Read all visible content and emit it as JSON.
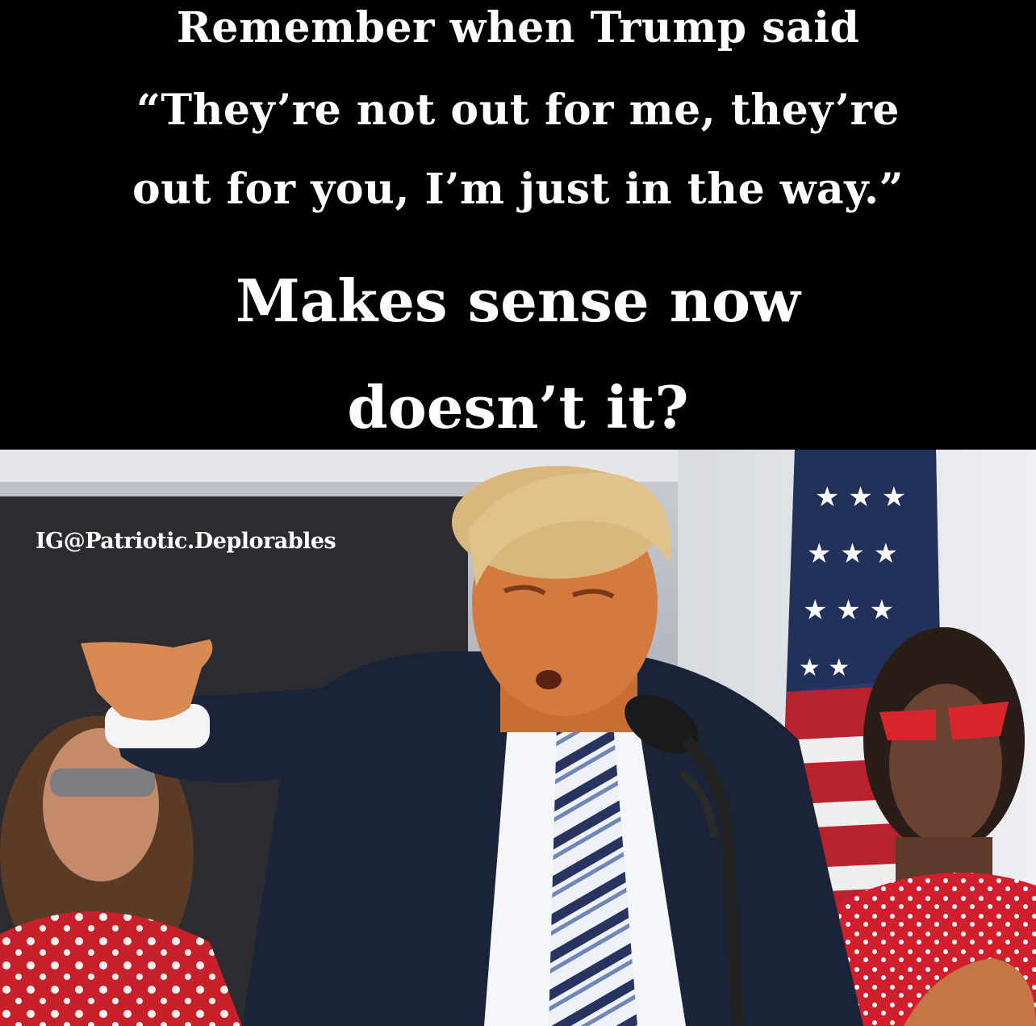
{
  "caption": {
    "line1": "Remember when Trump said",
    "line2": "“They’re not out for me, they’re",
    "line3": "out for you, I’m just in the way.”",
    "line4": "Makes sense now",
    "line5": "doesn’t it?"
  },
  "watermark": "IG@Patriotic.Deplorables",
  "colors": {
    "background": "#000000",
    "text": "#ffffff",
    "suit": "#1b2338",
    "skin": "#d57a3e",
    "hair": "#d9b77d",
    "dress_red": "#c8202a",
    "flag_blue": "#22315a"
  },
  "photo": {
    "subjects": [
      "man-pointing-at-microphone",
      "woman-left-sunglasses",
      "woman-right-red-sunglasses",
      "american-flag"
    ]
  }
}
